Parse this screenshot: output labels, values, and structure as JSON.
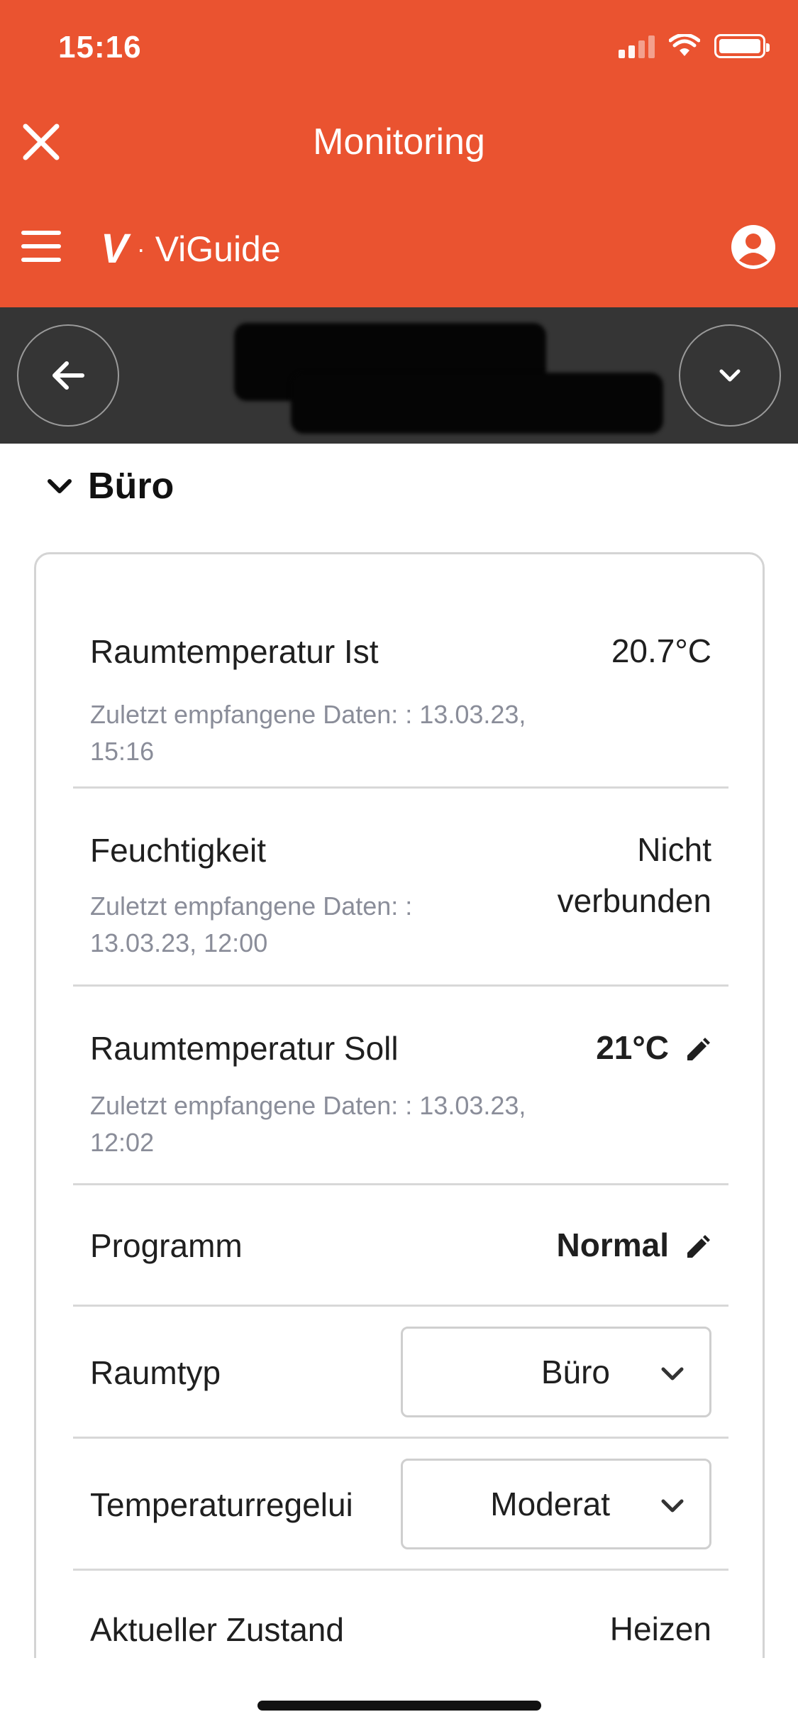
{
  "status_bar": {
    "time": "15:16"
  },
  "title_bar": {
    "title": "Monitoring"
  },
  "app_bar": {
    "brand_logo": "V",
    "brand_separator": "·",
    "brand_name": "ViGuide"
  },
  "section": {
    "title": "Büro"
  },
  "rows": [
    {
      "label": "Raumtemperatur Ist",
      "sub": "Zuletzt empfangene Daten: : 13.03.23, 15:16",
      "value": "20.7°C"
    },
    {
      "label": "Feuchtigkeit",
      "sub": "Zuletzt empfangene Daten: : 13.03.23, 12:00",
      "value": "Nicht verbunden"
    },
    {
      "label": "Raumtemperatur Soll",
      "sub": "Zuletzt empfangene Daten: : 13.03.23, 12:02",
      "value": "21°C"
    },
    {
      "label": "Programm",
      "value": "Normal"
    },
    {
      "label": "Raumtyp",
      "select_value": "Büro"
    },
    {
      "label": "Temperaturregelui",
      "select_value": "Moderat"
    },
    {
      "label": "Aktueller Zustand",
      "value": "Heizen"
    }
  ],
  "colors": {
    "brand": "#ea5330",
    "device_bar": "#353535",
    "muted_text": "#8a8d99"
  },
  "icons": [
    "close-icon",
    "menu-icon",
    "profile-icon",
    "back-arrow-icon",
    "chevron-down-icon",
    "pencil-icon"
  ]
}
